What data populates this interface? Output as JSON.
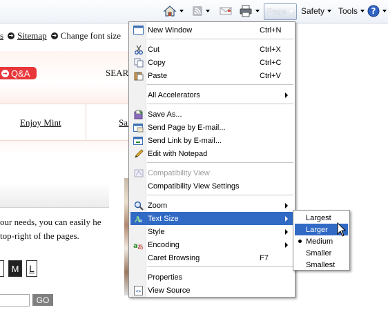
{
  "toolbar": {
    "page_label": "Page",
    "safety_label": "Safety",
    "tools_label": "Tools",
    "icons": [
      "home-icon",
      "feeds-icon",
      "read-mail-icon",
      "print-icon",
      "help-icon"
    ]
  },
  "page": {
    "topnav": [
      "s",
      "Sitemap",
      "Change font size"
    ],
    "qa_button": "Q&A",
    "search_label": "SEAR",
    "nav_links": [
      "Enjoy Mint",
      "Sai"
    ],
    "body_text": "our needs, you can easily he top-right of the pages.",
    "font_size_buttons": [
      "M",
      "L"
    ],
    "go_button": "GO"
  },
  "page_menu": {
    "items": [
      {
        "label": "New Window",
        "shortcut": "Ctrl+N",
        "icon": "new-window-icon"
      },
      {
        "label": "Cut",
        "shortcut": "Ctrl+X",
        "icon": "scissors-icon"
      },
      {
        "label": "Copy",
        "shortcut": "Ctrl+C",
        "icon": "copy-icon"
      },
      {
        "label": "Paste",
        "shortcut": "Ctrl+V",
        "icon": "paste-icon"
      },
      {
        "label": "All Accelerators",
        "submenu": true
      },
      {
        "label": "Save As...",
        "icon": "save-icon"
      },
      {
        "label": "Send Page by E-mail...",
        "icon": "email-page-icon"
      },
      {
        "label": "Send Link by E-mail...",
        "icon": "email-link-icon"
      },
      {
        "label": "Edit with Notepad",
        "icon": "pencil-icon"
      },
      {
        "label": "Compatibility View",
        "disabled": true,
        "icon": "compatibility-view-icon"
      },
      {
        "label": "Compatibility View Settings"
      },
      {
        "label": "Zoom",
        "submenu": true,
        "icon": "zoom-icon"
      },
      {
        "label": "Text Size",
        "submenu": true,
        "highlighted": true,
        "icon": "text-size-icon"
      },
      {
        "label": "Style",
        "submenu": true
      },
      {
        "label": "Encoding",
        "submenu": true,
        "icon": "encoding-icon"
      },
      {
        "label": "Caret Browsing",
        "shortcut": "F7"
      },
      {
        "label": "Properties"
      },
      {
        "label": "View Source",
        "icon": "view-source-icon"
      }
    ]
  },
  "text_size_menu": {
    "items": [
      "Largest",
      "Larger",
      "Medium",
      "Smaller",
      "Smallest"
    ],
    "highlighted": "Larger",
    "selected": "Medium"
  },
  "colors": {
    "highlight": "#316ac5",
    "qa_red": "#e8363a"
  }
}
